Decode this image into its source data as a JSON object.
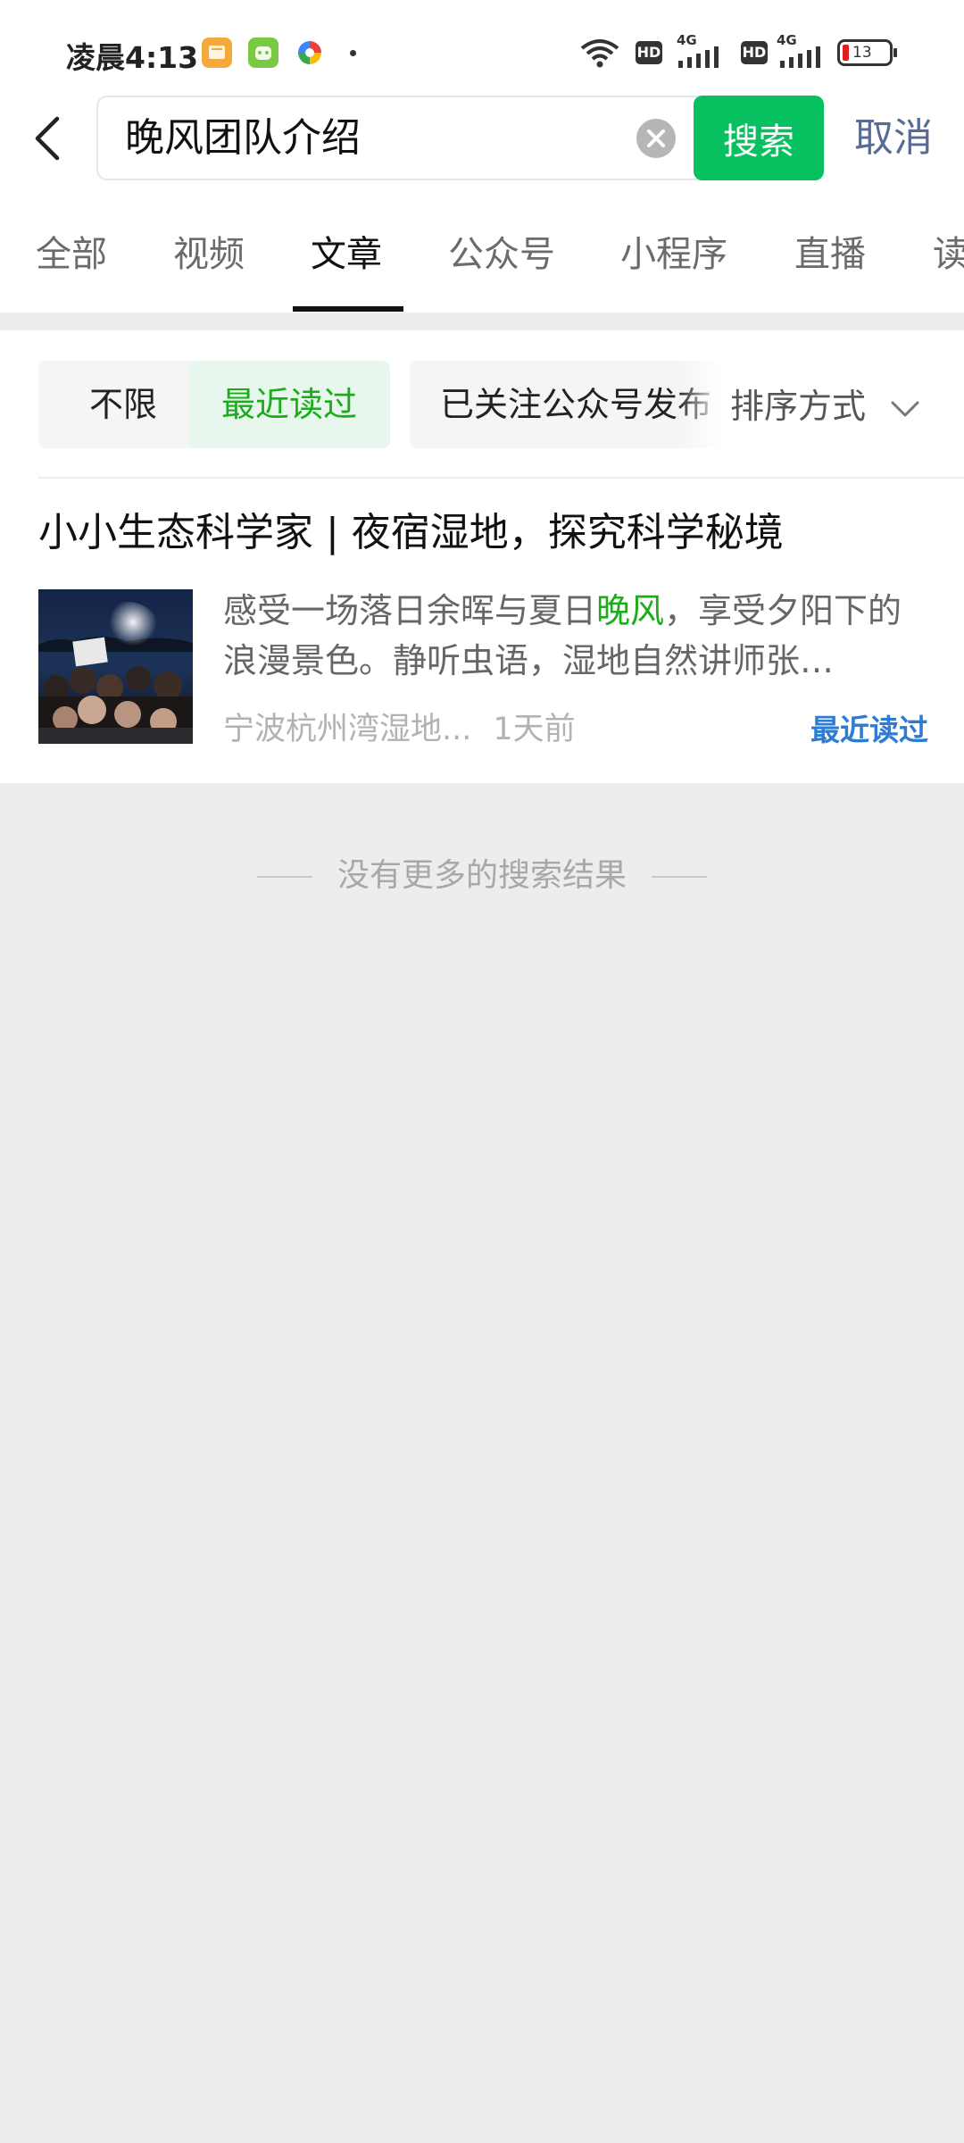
{
  "status_bar": {
    "time": "凌晨4:13",
    "hd1": "HD",
    "net1": "4G",
    "hd2": "HD",
    "net2": "4G",
    "battery": "13",
    "icons": [
      "gallery-app-icon",
      "green-app-icon",
      "colorful-app-icon",
      "dot-indicator",
      "wifi-icon",
      "signal-icon",
      "battery-icon"
    ]
  },
  "header": {
    "search_query": "晚风团队介绍",
    "search_label": "搜索",
    "cancel_label": "取消"
  },
  "tabs": [
    {
      "label": "全部"
    },
    {
      "label": "视频"
    },
    {
      "label": "文章"
    },
    {
      "label": "公众号"
    },
    {
      "label": "小程序"
    },
    {
      "label": "直播"
    },
    {
      "label": "读"
    }
  ],
  "active_tab": "文章",
  "filters": {
    "chips": [
      "不限",
      "最近读过",
      "已关注公众号发布"
    ],
    "selected": "最近读过",
    "sort_label": "排序方式"
  },
  "article": {
    "title": "小小生态科学家 | 夜宿湿地，探究科学秘境",
    "desc_before": "感受一场落日余晖与夏日",
    "desc_highlight": "晚风",
    "desc_after": "，享受夕阳下的浪漫景色。静听虫语，湿地自然讲师张…",
    "source": "宁波杭州湾湿地...",
    "time": "1天前",
    "tag": "最近读过"
  },
  "end_message": "没有更多的搜索结果",
  "colors": {
    "accent_green": "#07c160",
    "highlight_green": "#1aad19",
    "link_blue": "#576b95",
    "tag_blue": "#2d7bd2",
    "background": "#ededed"
  }
}
